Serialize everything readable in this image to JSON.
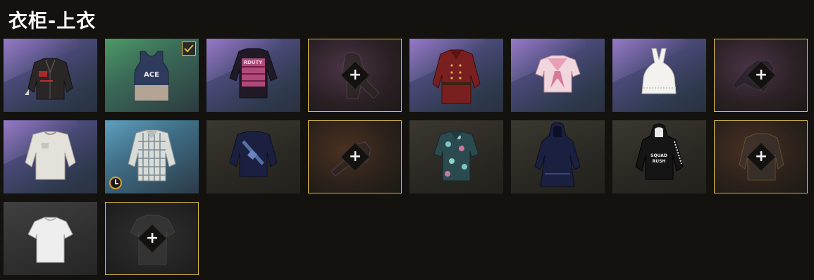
{
  "title": "衣柜-上衣",
  "colors": {
    "gold_accent": "#d9b948",
    "clock_accent": "#e0a030",
    "background": "#14120e"
  },
  "items": [
    {
      "name": "leather-jacket",
      "bg": "purple",
      "equipped": false,
      "empty": false,
      "timed": false
    },
    {
      "name": "ace-tank-top",
      "bg": "green",
      "equipped": true,
      "empty": false,
      "timed": false
    },
    {
      "name": "pink-graphic-shirt",
      "bg": "purple",
      "equipped": false,
      "empty": false,
      "timed": false
    },
    {
      "name": "empty-slot-plus",
      "bg": "empty-purple",
      "equipped": false,
      "empty": true,
      "timed": false
    },
    {
      "name": "red-military-coat",
      "bg": "purple",
      "equipped": false,
      "empty": false,
      "timed": false
    },
    {
      "name": "pink-sailor-top",
      "bg": "purple",
      "equipped": false,
      "empty": false,
      "timed": false
    },
    {
      "name": "white-halter-top",
      "bg": "purple",
      "equipped": false,
      "empty": false,
      "timed": false
    },
    {
      "name": "empty-slot-plus",
      "bg": "empty-purple",
      "equipped": false,
      "empty": true,
      "timed": false
    },
    {
      "name": "white-sweatshirt",
      "bg": "purple",
      "equipped": false,
      "empty": false,
      "timed": false
    },
    {
      "name": "plaid-shirt",
      "bg": "blue",
      "equipped": false,
      "empty": false,
      "timed": true
    },
    {
      "name": "navy-sweater",
      "bg": "dark",
      "equipped": false,
      "empty": false,
      "timed": false
    },
    {
      "name": "empty-slot-plus",
      "bg": "empty-brown",
      "equipped": false,
      "empty": true,
      "timed": false
    },
    {
      "name": "floral-hawaiian-shirt",
      "bg": "dark",
      "equipped": false,
      "empty": false,
      "timed": false
    },
    {
      "name": "navy-hooded-dress",
      "bg": "dark",
      "equipped": false,
      "empty": false,
      "timed": false
    },
    {
      "name": "black-hoodie",
      "bg": "dark",
      "equipped": false,
      "empty": false,
      "timed": false
    },
    {
      "name": "empty-slot-plus",
      "bg": "empty-brown",
      "equipped": false,
      "empty": true,
      "timed": false
    },
    {
      "name": "white-tshirt",
      "bg": "grey",
      "equipped": false,
      "empty": false,
      "timed": false
    },
    {
      "name": "empty-slot-plus",
      "bg": "empty-grey",
      "equipped": false,
      "empty": true,
      "timed": false
    }
  ],
  "plus_symbol": "+"
}
